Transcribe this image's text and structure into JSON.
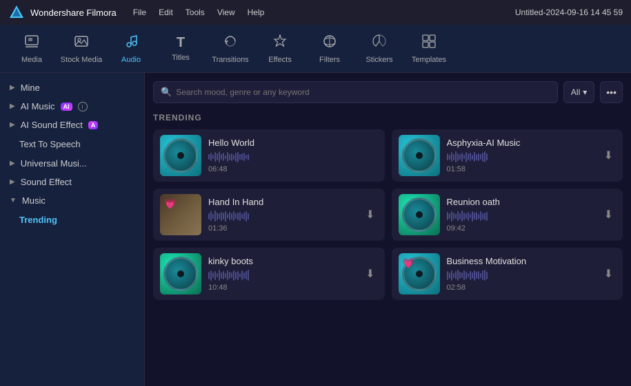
{
  "titleBar": {
    "appName": "Wondershare Filmora",
    "menuItems": [
      "File",
      "Edit",
      "Tools",
      "View",
      "Help"
    ],
    "windowTitle": "Untitled-2024-09-16 14 45 59"
  },
  "toolbar": {
    "items": [
      {
        "id": "media",
        "label": "Media",
        "icon": "🖼",
        "active": false
      },
      {
        "id": "stock-media",
        "label": "Stock Media",
        "icon": "📷",
        "active": false
      },
      {
        "id": "audio",
        "label": "Audio",
        "icon": "🎵",
        "active": true
      },
      {
        "id": "titles",
        "label": "Titles",
        "icon": "T",
        "active": false
      },
      {
        "id": "transitions",
        "label": "Transitions",
        "icon": "↔",
        "active": false
      },
      {
        "id": "effects",
        "label": "Effects",
        "icon": "✨",
        "active": false
      },
      {
        "id": "filters",
        "label": "Filters",
        "icon": "🎨",
        "active": false
      },
      {
        "id": "stickers",
        "label": "Stickers",
        "icon": "🔖",
        "active": false
      },
      {
        "id": "templates",
        "label": "Templates",
        "icon": "⊞",
        "active": false
      }
    ]
  },
  "sidebar": {
    "sections": [
      {
        "id": "mine",
        "label": "Mine",
        "arrow": "▶",
        "expanded": false
      },
      {
        "id": "ai-music",
        "label": "AI Music",
        "arrow": "▶",
        "expanded": false,
        "badge": "AI"
      },
      {
        "id": "ai-sound-effect",
        "label": "AI Sound Effect",
        "arrow": "▶",
        "expanded": false,
        "badge": "A"
      },
      {
        "id": "text-to-speech",
        "label": "Text To Speech",
        "arrow": "",
        "expanded": false
      },
      {
        "id": "universal-music",
        "label": "Universal Musi...",
        "arrow": "▶",
        "expanded": false
      },
      {
        "id": "sound-effect",
        "label": "Sound Effect",
        "arrow": "▶",
        "expanded": false
      },
      {
        "id": "music",
        "label": "Music",
        "arrow": "▼",
        "expanded": true
      }
    ],
    "musicChildren": [
      {
        "id": "trending",
        "label": "Trending",
        "active": true
      }
    ]
  },
  "content": {
    "search": {
      "placeholder": "Search mood, genre or any keyword",
      "filterLabel": "All",
      "moreIcon": "•••"
    },
    "trendingLabel": "TRENDING",
    "cards": [
      {
        "id": "hello-world",
        "title": "Hello World",
        "duration": "06:48",
        "thumb": "teal",
        "hasHeart": false,
        "downloadable": false
      },
      {
        "id": "asphyxia",
        "title": "Asphyxia-AI Music",
        "duration": "01:58",
        "thumb": "teal",
        "hasHeart": false,
        "downloadable": true
      },
      {
        "id": "hand-in-hand",
        "title": "Hand In Hand",
        "duration": "01:36",
        "thumb": "nature",
        "hasHeart": true,
        "downloadable": true
      },
      {
        "id": "reunion-oath",
        "title": "Reunion oath",
        "duration": "09:42",
        "thumb": "teal",
        "hasHeart": false,
        "downloadable": true
      },
      {
        "id": "kinky-boots",
        "title": "kinky boots",
        "duration": "10:48",
        "thumb": "teal2",
        "hasHeart": false,
        "downloadable": true
      },
      {
        "id": "business-motivation",
        "title": "Business Motivation",
        "duration": "02:58",
        "thumb": "teal",
        "hasHeart": true,
        "downloadable": true
      }
    ]
  },
  "colors": {
    "accent": "#4fc3f7",
    "bg": "#12122a",
    "sidebar": "#16213e",
    "card": "#1e1e38"
  }
}
